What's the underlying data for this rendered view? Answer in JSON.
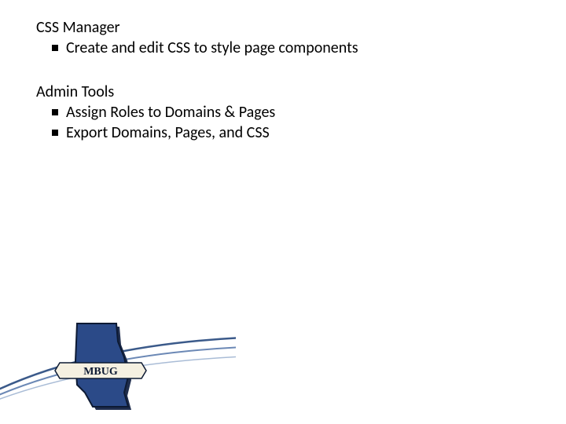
{
  "sections": [
    {
      "title": "CSS Manager",
      "bullets": [
        "Create and edit CSS to style page components"
      ]
    },
    {
      "title": "Admin Tools",
      "bullets": [
        "Assign Roles to Domains & Pages",
        "Export Domains, Pages, and CSS"
      ]
    }
  ],
  "logo": {
    "banner_text": "MBUG"
  }
}
